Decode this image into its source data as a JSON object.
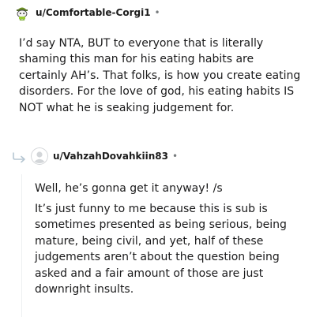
{
  "comment": {
    "username": "u/Comfortable-Corgi1",
    "separator": "•",
    "body": "I’d say NTA, BUT to everyone that is literally shaming this man for his eating habits are certainly AH’s. That folks, is how you create eating disorders. For the love of god, his eating habits IS NOT what he is seaking judgement for."
  },
  "reply": {
    "username": "u/VahzahDovahkiin83",
    "separator": "•",
    "paragraphs": [
      "Well, he’s gonna get it anyway! /s",
      "It’s just funny to me because this is sub is sometimes presented as being serious, being mature, being civil, and yet, half of these judgements aren’t about the question being asked and a fair amount of those are just downright insults."
    ]
  },
  "colors": {
    "text": "#1a1a1b",
    "meta_gray": "#787c7e",
    "thread_line": "#edeff1",
    "avatar_default": "#c8cbcd"
  },
  "icons": [
    "snoo-avatar-icon",
    "default-avatar-icon",
    "reply-arrow-icon"
  ]
}
